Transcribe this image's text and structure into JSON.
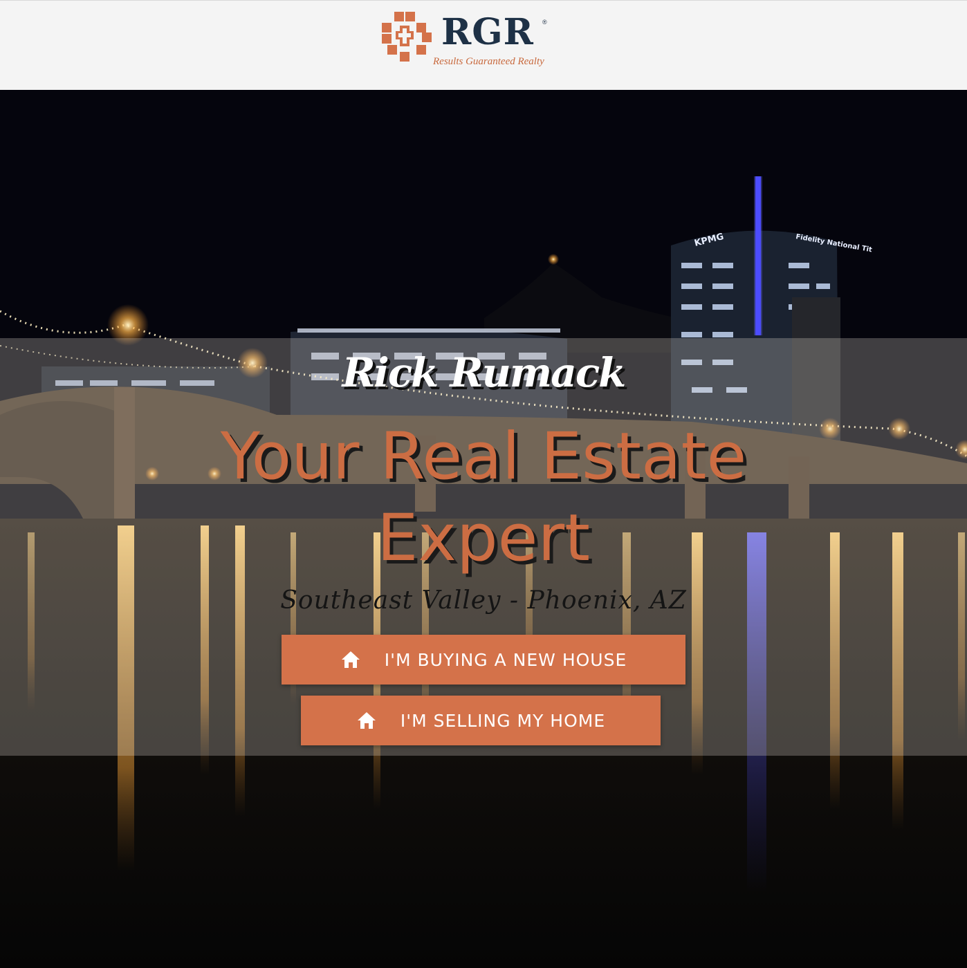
{
  "header": {
    "logo": {
      "name": "RGR",
      "trademark": "®",
      "tagline": "Results Guaranteed Realty"
    }
  },
  "hero": {
    "agent_name": "Rick Rumack",
    "headline_line1": "Your Real Estate",
    "headline_line2": "Expert",
    "region": "Southeast Valley - Phoenix, AZ",
    "buttons": [
      {
        "label": "I'M BUYING A NEW HOUSE",
        "icon": "home-icon"
      },
      {
        "label": "I'M SELLING MY HOME",
        "icon": "home-icon"
      }
    ],
    "building_signs": [
      "KPMG",
      "Fidelity National Tit"
    ]
  },
  "colors": {
    "brand_orange": "#d4724a",
    "brand_navy": "#1e3146",
    "header_bg": "#f4f4f4",
    "headline_orange": "#cc6d43"
  }
}
